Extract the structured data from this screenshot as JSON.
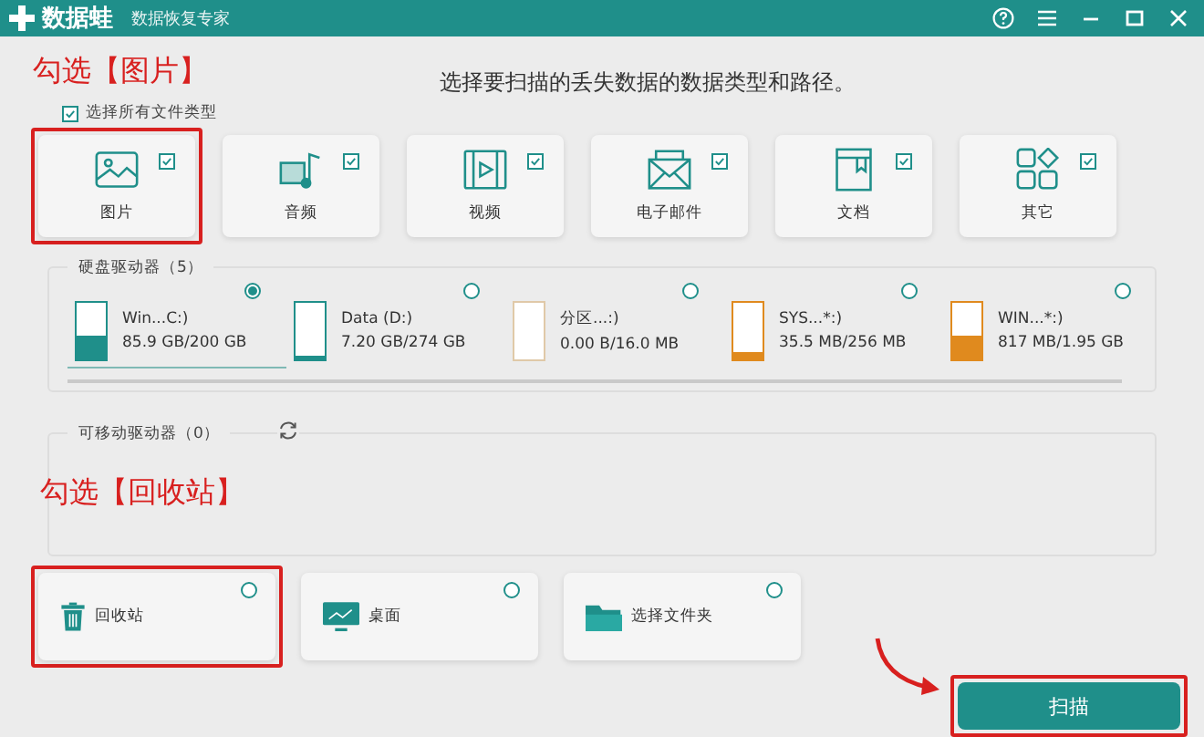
{
  "window": {
    "app_name": "数据蛙",
    "subtitle": "数据恢复专家"
  },
  "heading": "选择要扫描的丢失数据的数据类型和路径。",
  "select_all": {
    "label": "选择所有文件类型",
    "checked": true
  },
  "file_types": [
    {
      "kind": "image",
      "label": "图片",
      "checked": true,
      "highlighted": true
    },
    {
      "kind": "audio",
      "label": "音频",
      "checked": true,
      "highlighted": false
    },
    {
      "kind": "video",
      "label": "视频",
      "checked": true,
      "highlighted": false
    },
    {
      "kind": "email",
      "label": "电子邮件",
      "checked": true,
      "highlighted": false
    },
    {
      "kind": "document",
      "label": "文档",
      "checked": true,
      "highlighted": false
    },
    {
      "kind": "other",
      "label": "其它",
      "checked": true,
      "highlighted": false
    }
  ],
  "hard_drives": {
    "title": "硬盘驱动器（5）",
    "drives": [
      {
        "name": "Win...C:)",
        "usage": "85.9 GB/200 GB",
        "level": 0.43,
        "color": "#1f8f8a",
        "selected": true
      },
      {
        "name": "Data (D:)",
        "usage": "7.20 GB/274 GB",
        "level": 0.03,
        "color": "#1f8f8a",
        "selected": false
      },
      {
        "name": "分区...:)",
        "usage": "0.00  B/16.0 MB",
        "level": 0,
        "color": "#e0c9a8",
        "selected": false
      },
      {
        "name": "SYS...*:)",
        "usage": "35.5 MB/256 MB",
        "level": 0.14,
        "color": "#e08a1e",
        "selected": false
      },
      {
        "name": "WIN...*:)",
        "usage": "817 MB/1.95 GB",
        "level": 0.42,
        "color": "#e08a1e",
        "selected": false
      }
    ]
  },
  "removable_drives": {
    "title": "可移动驱动器（0）"
  },
  "locations": [
    {
      "kind": "trash",
      "label": "回收站",
      "selected": false,
      "highlighted": true
    },
    {
      "kind": "desktop",
      "label": "桌面",
      "selected": false,
      "highlighted": false
    },
    {
      "kind": "folder",
      "label": "选择文件夹",
      "selected": false,
      "highlighted": false
    }
  ],
  "scan_button": {
    "label": "扫描",
    "highlighted": true
  },
  "annotations": [
    "勾选【图片】",
    "勾选【回收站】"
  ]
}
